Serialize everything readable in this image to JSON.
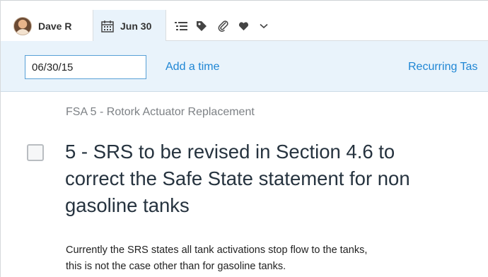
{
  "toolbar": {
    "assignee": {
      "name": "Dave R",
      "icon": "avatar"
    },
    "due_date": {
      "label": "Jun 30",
      "icon": "calendar-icon"
    },
    "tools": [
      {
        "name": "subtasks-icon"
      },
      {
        "name": "tag-icon"
      },
      {
        "name": "attachment-icon"
      },
      {
        "name": "heart-icon"
      },
      {
        "name": "chevron-down-icon"
      }
    ]
  },
  "datebar": {
    "date_value": "06/30/15",
    "add_time_label": "Add a time",
    "recurring_label": "Recurring Tas"
  },
  "task": {
    "project": "FSA 5 - Rotork Actuator Replacement",
    "title_lines": [
      "5 - SRS to be revised in Section 4.6 to",
      "correct the Safe State statement for non",
      "gasoline tanks"
    ],
    "notes_lines": [
      "Currently the SRS states all tank activations stop flow to the tanks,",
      "this is not the case other than for gasoline tanks."
    ]
  },
  "colors": {
    "accent": "#1f86d4",
    "datebar_bg": "#e9f3fb",
    "input_border": "#58a0d6"
  }
}
